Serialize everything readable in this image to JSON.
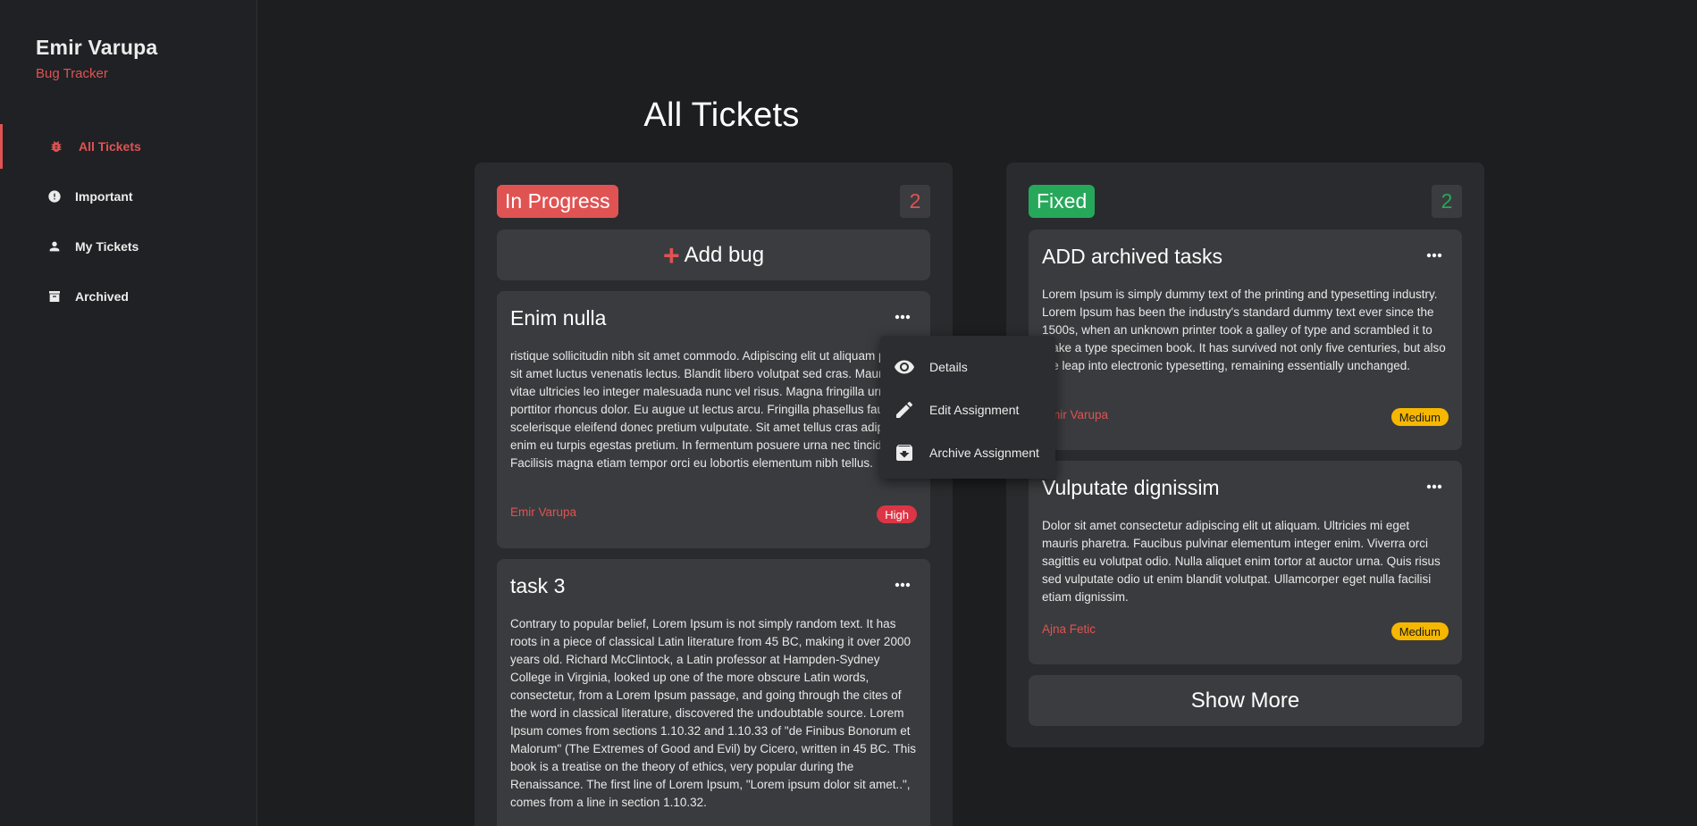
{
  "sidebar": {
    "brand_name": "Emir Varupa",
    "brand_sub": "Bug Tracker",
    "items": [
      {
        "label": "All Tickets",
        "icon": "bug-icon"
      },
      {
        "label": "Important",
        "icon": "alert-circle-icon"
      },
      {
        "label": "My Tickets",
        "icon": "person-icon"
      },
      {
        "label": "Archived",
        "icon": "archive-icon"
      }
    ]
  },
  "page": {
    "title": "All Tickets"
  },
  "columns": [
    {
      "status": "In Progress",
      "count": "2",
      "add_label": "Add bug",
      "cards": [
        {
          "title": "Enim nulla",
          "body": "ristique sollicitudin nibh sit amet commodo. Adipiscing elit ut aliquam purus sit amet luctus venenatis lectus. Blandit libero volutpat sed cras. Mauris vitae ultricies leo integer malesuada nunc vel risus. Magna fringilla urna porttitor rhoncus dolor. Eu augue ut lectus arcu. Fringilla phasellus faucibus scelerisque eleifend donec pretium vulputate. Sit amet tellus cras adipiscing enim eu turpis egestas pretium. In fermentum posuere urna nec tincidunt. Facilisis magna etiam tempor orci eu lobortis elementum nibh tellus.",
          "author": "Emir Varupa",
          "priority": "High"
        },
        {
          "title": "task 3",
          "body": "Contrary to popular belief, Lorem Ipsum is not simply random text. It has roots in a piece of classical Latin literature from 45 BC, making it over 2000 years old. Richard McClintock, a Latin professor at Hampden-Sydney College in Virginia, looked up one of the more obscure Latin words, consectetur, from a Lorem Ipsum passage, and going through the cites of the word in classical literature, discovered the undoubtable source. Lorem Ipsum comes from sections 1.10.32 and 1.10.33 of \"de Finibus Bonorum et Malorum\" (The Extremes of Good and Evil) by Cicero, written in 45 BC. This book is a treatise on the theory of ethics, very popular during the Renaissance. The first line of Lorem Ipsum, \"Lorem ipsum dolor sit amet..\", comes from a line in section 1.10.32."
        }
      ]
    },
    {
      "status": "Fixed",
      "count": "2",
      "show_more": "Show More",
      "cards": [
        {
          "title": "ADD archived tasks",
          "body": "Lorem Ipsum is simply dummy text of the printing and typesetting industry. Lorem Ipsum has been the industry's standard dummy text ever since the 1500s, when an unknown printer took a galley of type and scrambled it to make a type specimen book. It has survived not only five centuries, but also the leap into electronic typesetting, remaining essentially unchanged.",
          "author": "Emir Varupa",
          "priority": "Medium"
        },
        {
          "title": "Vulputate dignissim",
          "body": "Dolor sit amet consectetur adipiscing elit ut aliquam. Ultricies mi eget mauris pharetra. Faucibus pulvinar elementum integer enim. Viverra orci sagittis eu volutpat odio. Nulla aliquet enim tortor at auctor urna. Quis risus sed vulputate odio ut enim blandit volutpat. Ullamcorper eget nulla facilisi etiam dignissim.",
          "author": "Ajna Fetic",
          "priority": "Medium"
        }
      ]
    }
  ],
  "menu": {
    "items": [
      {
        "label": "Details",
        "icon": "eye-icon"
      },
      {
        "label": "Edit Assignment",
        "icon": "pencil-icon"
      },
      {
        "label": "Archive Assignment",
        "icon": "archive-icon"
      }
    ]
  },
  "colors": {
    "accent": "#e05353",
    "fixed": "#26a85a",
    "high": "#dc3545",
    "medium": "#f5b700",
    "background": "#1d1e20",
    "card": "#3a3b3e"
  }
}
